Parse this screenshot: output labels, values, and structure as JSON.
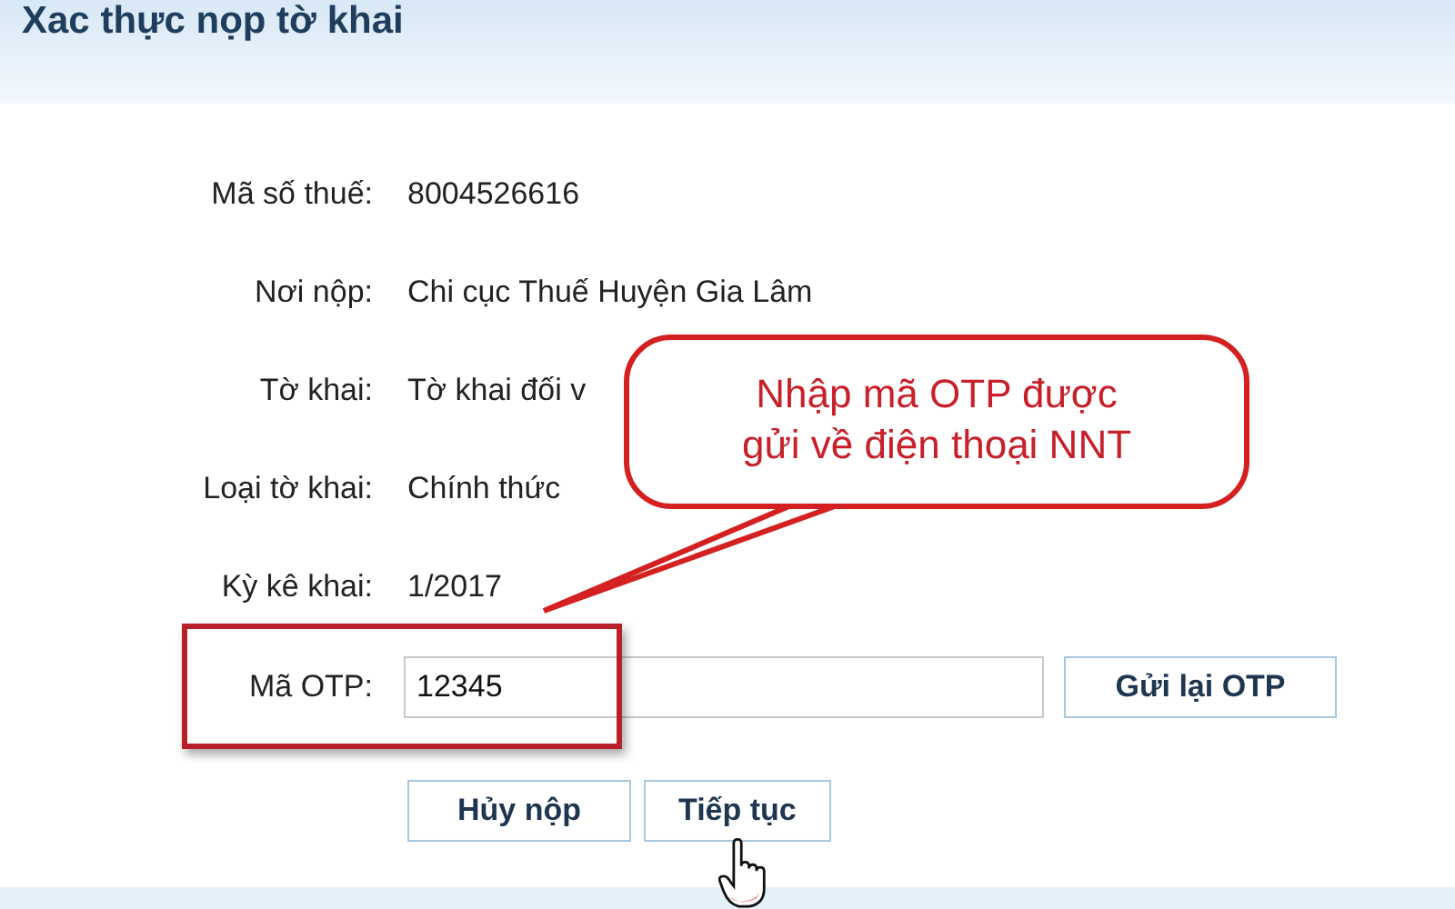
{
  "header": {
    "title": "Xac thực nọp tờ khai"
  },
  "fields": [
    {
      "label": "Mã số thuế:",
      "value": "8004526616"
    },
    {
      "label": "Nơi nộp:",
      "value": "Chi cục Thuế Huyện Gia Lâm"
    },
    {
      "label": "Tờ khai:",
      "value": "Tờ khai đối v"
    },
    {
      "label": "Loại tờ khai:",
      "value": "Chính thức"
    },
    {
      "label": "Kỳ kê khai:",
      "value": "1/2017"
    }
  ],
  "otp": {
    "label": "Mã OTP:",
    "value": "12345",
    "resend_button": "Gửi lại OTP"
  },
  "buttons": [
    "Hủy nộp",
    "Tiếp tục"
  ],
  "callout": {
    "lines": [
      "Nhập mã OTP được",
      "gửi về điện thoại NNT"
    ]
  }
}
